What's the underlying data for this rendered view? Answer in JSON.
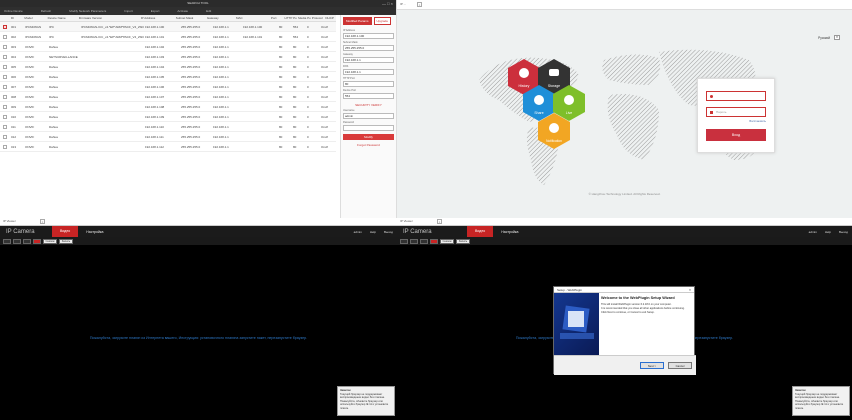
{
  "q1": {
    "title": "SEARCH TOOL",
    "window_controls": "— □ ×",
    "menu": [
      "Online Device",
      "Refresh",
      "Modify Network Parameters",
      "Import",
      "Export",
      "Activate",
      "Edit"
    ],
    "columns": [
      "",
      "ID",
      "Model",
      "Device Name",
      "Firmware Version",
      "IP Address",
      "Subnet Mask",
      "Gateway",
      "MAC",
      "Port",
      "HTTP Port",
      "Media Port",
      "Protocol",
      "DHCP"
    ],
    "rows": [
      {
        "id": "001",
        "model": "IPC6406GN",
        "type": "IPC",
        "name": "IPC6406GN-ICC_v4.*EP*ARM*8SCF_V4_2SD0F",
        "fw": "192.168.1.100",
        "ip": "255.255.255.0",
        "mask": "192.168.1.1",
        "gw": "192.168.1.100",
        "mac": "27:00:1f:ed:fa",
        "port": "80",
        "http": "554",
        "media": "0",
        "proto": "Onvif",
        "sel": true
      },
      {
        "id": "002",
        "model": "IPC6406GN",
        "type": "IPC",
        "name": "IPC6406GN-ICC_v4.*EP*ARM*8SCF_V4_2SD0F",
        "fw": "192.168.1.101",
        "ip": "255.255.255.0",
        "mask": "192.168.1.1",
        "gw": "192.168.1.101",
        "mac": "00:00:00:00:00:00",
        "port": "80",
        "http": "554",
        "media": "0",
        "proto": "Onvif",
        "sel": false
      },
      {
        "id": "003",
        "model": "ONVIF",
        "type": "Dahua",
        "name": "",
        "fw": "192.168.1.102",
        "ip": "255.255.255.0",
        "mask": "192.168.1.1",
        "gw": "",
        "mac": "00:00:00:00:00:00",
        "port": "80",
        "http": "80",
        "media": "0",
        "proto": "Onvif",
        "sel": false
      },
      {
        "id": "004",
        "model": "ONVIF",
        "type": "NETSURVEILLANCE",
        "name": "",
        "fw": "192.168.1.103",
        "ip": "255.255.255.0",
        "mask": "192.168.1.1",
        "gw": "",
        "mac": "00:00:00:00:00:00",
        "port": "80",
        "http": "80",
        "media": "0",
        "proto": "Onvif",
        "sel": false
      },
      {
        "id": "005",
        "model": "ONVIF",
        "type": "Dahua",
        "name": "",
        "fw": "192.168.1.104",
        "ip": "255.255.255.0",
        "mask": "192.168.1.1",
        "gw": "",
        "mac": "00:00:00:00:00:00",
        "port": "80",
        "http": "80",
        "media": "0",
        "proto": "Onvif",
        "sel": false
      },
      {
        "id": "006",
        "model": "ONVIF",
        "type": "Dahua",
        "name": "",
        "fw": "192.168.1.105",
        "ip": "255.255.255.0",
        "mask": "192.168.1.1",
        "gw": "",
        "mac": "00:00:00:00:00:00",
        "port": "80",
        "http": "80",
        "media": "0",
        "proto": "Onvif",
        "sel": false
      },
      {
        "id": "007",
        "model": "ONVIF",
        "type": "Dahua",
        "name": "",
        "fw": "192.168.1.106",
        "ip": "255.255.255.0",
        "mask": "192.168.1.1",
        "gw": "",
        "mac": "00:00:00:00:00:00",
        "port": "80",
        "http": "80",
        "media": "0",
        "proto": "Onvif",
        "sel": false
      },
      {
        "id": "008",
        "model": "ONVIF",
        "type": "Dahua",
        "name": "",
        "fw": "192.168.1.107",
        "ip": "255.255.255.0",
        "mask": "192.168.1.1",
        "gw": "",
        "mac": "00:00:00:00:00:00",
        "port": "80",
        "http": "80",
        "media": "0",
        "proto": "Onvif",
        "sel": false
      },
      {
        "id": "009",
        "model": "ONVIF",
        "type": "Dahua",
        "name": "",
        "fw": "192.168.1.108",
        "ip": "255.255.255.0",
        "mask": "192.168.1.1",
        "gw": "",
        "mac": "00:00:00:00:00:00",
        "port": "80",
        "http": "80",
        "media": "0",
        "proto": "Onvif",
        "sel": false
      },
      {
        "id": "010",
        "model": "ONVIF",
        "type": "Dahua",
        "name": "",
        "fw": "192.168.1.109",
        "ip": "255.255.255.0",
        "mask": "192.168.1.1",
        "gw": "",
        "mac": "00:00:00:00:00:00",
        "port": "80",
        "http": "80",
        "media": "0",
        "proto": "Onvif",
        "sel": false
      },
      {
        "id": "011",
        "model": "ONVIF",
        "type": "Dahua",
        "name": "",
        "fw": "192.168.1.110",
        "ip": "255.255.255.0",
        "mask": "192.168.1.1",
        "gw": "",
        "mac": "00:00:00:00:00:00",
        "port": "80",
        "http": "80",
        "media": "0",
        "proto": "Onvif",
        "sel": false
      },
      {
        "id": "012",
        "model": "ONVIF",
        "type": "Dahua",
        "name": "",
        "fw": "192.168.1.111",
        "ip": "255.255.255.0",
        "mask": "192.168.1.1",
        "gw": "",
        "mac": "00:00:00:00:00:00",
        "port": "80",
        "http": "80",
        "media": "0",
        "proto": "Onvif",
        "sel": false
      },
      {
        "id": "013",
        "model": "ONVIF",
        "type": "Dahua",
        "name": "",
        "fw": "192.168.1.112",
        "ip": "255.255.255.0",
        "mask": "192.168.1.1",
        "gw": "",
        "mac": "00:00:00:00:00:00",
        "port": "80",
        "http": "80",
        "media": "0",
        "proto": "Onvif",
        "sel": false
      }
    ],
    "panel": {
      "tab_active": "Modified Params",
      "tab_other": "Upgrade",
      "labels": [
        "IP Address",
        "Subnet Mask",
        "Gateway",
        "DNS",
        "HTTP Port",
        "Device Port"
      ],
      "values": [
        "192.168.1.100",
        "255.255.255.0",
        "192.168.1.1",
        "192.168.1.1",
        "80",
        "554"
      ],
      "security": "SECURITY VERIFY",
      "user_label": "Username",
      "user": "admin",
      "pass_label": "Password",
      "modify": "Modify",
      "forgot": "Forgot Password"
    }
  },
  "q2": {
    "tab": "IP ...",
    "language": "Русский",
    "tiles": [
      "History",
      "Storage",
      "Share",
      "Live",
      "Notification"
    ],
    "user_placeholder": "",
    "pass_placeholder": "Пароль",
    "forgot": "Восстановить",
    "login": "Вход",
    "copyright": "© Hangzhou Technology Limited. All Rights Reserved."
  },
  "q3": {
    "tab": "IP Viewer",
    "brand": "IP Camera",
    "nav_active": "Видео",
    "nav_settings": "Настройка",
    "user": "admin",
    "help": "Help",
    "logout": "Выход",
    "btn1": "Снимок",
    "btn2": "Запись",
    "message": "Пожалуйста, загрузите плагин из Интернета вашего, Инструкция: установочного плагина запустите пакет, перезапустите браузер.",
    "tip_title": "Заметки",
    "tip_body": "Текущий браузер не поддерживает воспроизведение видео без плагина. Пожалуйста, обновите браузер или используйте браузер IE 11 и установите плагин.",
    "footer": "© ..."
  },
  "q4": {
    "tab": "IP Viewer",
    "brand": "IP Camera",
    "nav_active": "Видео",
    "nav_settings": "Настройка",
    "user": "admin",
    "help": "Help",
    "logout": "Выход",
    "btn1": "Снимок",
    "btn2": "Запись",
    "message": "Пожалуйста, загрузите плагин из Интернета вашего, Инструкция: установочного плагина запустите пакет, перезапустите браузер.",
    "tip_title": "Заметки",
    "tip_body": "Текущий браузер не поддерживает воспроизведение видео без плагина. Пожалуйста, обновите браузер или используйте браузер IE 11 и установите плагин.",
    "installer": {
      "title": "Setup - WebPlugin",
      "close": "×",
      "heading": "Welcome to the WebPlugin Setup Wizard",
      "body1": "This will install WebPlugin version 6.2.18.0 on your computer.",
      "body2": "It is recommended that you close all other applications before continuing.",
      "body3": "Click Next to continue, or Cancel to exit Setup.",
      "next": "Next >",
      "cancel": "Cancel"
    }
  },
  "colors": {
    "accent": "#c9303e",
    "map_red": "#cc2f3c",
    "map_dark": "#333333",
    "map_blue": "#1f8fd8",
    "map_green": "#7ebf2a",
    "map_yellow": "#f2a623"
  }
}
